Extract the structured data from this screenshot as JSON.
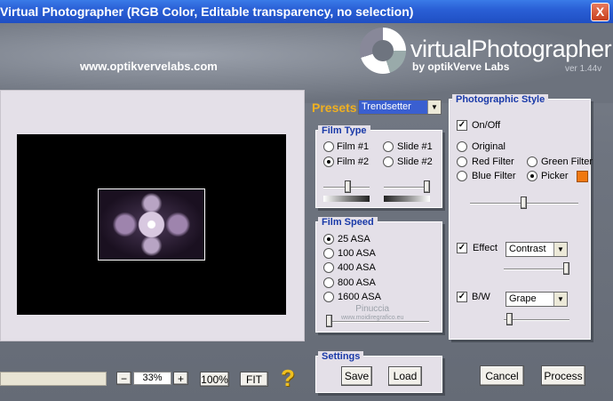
{
  "window": {
    "title": "Virtual Photographer (RGB Color, Editable transparency, no selection)",
    "close_label": "X"
  },
  "branding": {
    "url": "www.optikvervelabs.com",
    "logo_name": "virtualPhotographer",
    "logo_by": "by optikVerve Labs",
    "version": "ver 1.44v"
  },
  "preview": {
    "zoom_minus": "−",
    "zoom_value": "33%",
    "zoom_plus": "+",
    "btn_100": "100%",
    "btn_fit": "FIT",
    "help": "?"
  },
  "presets": {
    "label": "Presets",
    "selected": "Trendsetter"
  },
  "film_type": {
    "title": "Film Type",
    "options": [
      {
        "label": "Film #1",
        "selected": false
      },
      {
        "label": "Slide #1",
        "selected": false
      },
      {
        "label": "Film #2",
        "selected": true
      },
      {
        "label": "Slide #2",
        "selected": false
      }
    ],
    "slider_left": 0.42,
    "slider_right": 0.9
  },
  "film_speed": {
    "title": "Film Speed",
    "options": [
      {
        "label": "25 ASA",
        "selected": true
      },
      {
        "label": "100 ASA",
        "selected": false
      },
      {
        "label": "400 ASA",
        "selected": false
      },
      {
        "label": "800 ASA",
        "selected": false
      },
      {
        "label": "1600 ASA",
        "selected": false
      }
    ],
    "slider": 0.02
  },
  "settings": {
    "title": "Settings",
    "save": "Save",
    "load": "Load"
  },
  "photo_style": {
    "title": "Photographic Style",
    "onoff_label": "On/Off",
    "onoff_checked": true,
    "options": [
      {
        "label": "Original",
        "selected": false
      },
      {
        "label": "Red Filter",
        "selected": false
      },
      {
        "label": "Green Filter",
        "selected": false
      },
      {
        "label": "Blue Filter",
        "selected": false
      },
      {
        "label": "Picker",
        "selected": true
      }
    ],
    "picker_color": "#f07810",
    "slider": 0.5,
    "effect_label": "Effect",
    "effect_checked": true,
    "effect_value": "Contrast",
    "effect_slider": 0.97,
    "bw_label": "B/W",
    "bw_checked": true,
    "bw_value": "Grape",
    "bw_slider": 0.05
  },
  "actions": {
    "cancel": "Cancel",
    "process": "Process"
  },
  "watermark": {
    "line1": "Pinuccia",
    "line2": "www.moidiregrafico.eu"
  },
  "colors": {
    "title_bar": "#2a5fd6",
    "panel_bg": "#e4e0e8",
    "panel_title": "#1a3aa8",
    "presets_label": "#f0b020",
    "help": "#f0c020"
  }
}
